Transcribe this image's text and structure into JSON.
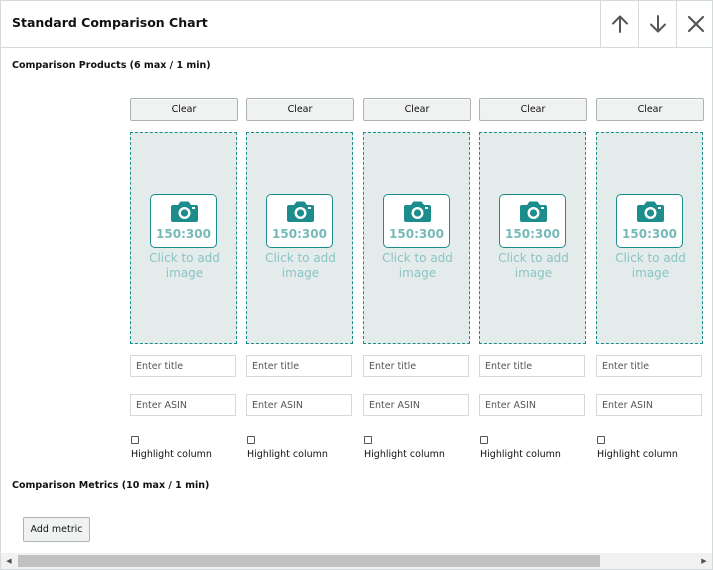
{
  "header": {
    "title": "Standard Comparison Chart",
    "move_up_icon": "arrow-up-icon",
    "move_down_icon": "arrow-down-icon",
    "remove_icon": "close-icon"
  },
  "products_section": {
    "label": "Comparison Products (6 max / 1 min)",
    "columns": [
      {
        "clear_label": "Clear",
        "image_ratio": "150:300",
        "add_image_text": "Click to add image",
        "title_placeholder": "Enter title",
        "asin_placeholder": "Enter ASIN",
        "highlight_label": "Highlight column",
        "highlighted": false
      },
      {
        "clear_label": "Clear",
        "image_ratio": "150:300",
        "add_image_text": "Click to add image",
        "title_placeholder": "Enter title",
        "asin_placeholder": "Enter ASIN",
        "highlight_label": "Highlight column",
        "highlighted": false
      },
      {
        "clear_label": "Clear",
        "image_ratio": "150:300",
        "add_image_text": "Click to add image",
        "title_placeholder": "Enter title",
        "asin_placeholder": "Enter ASIN",
        "highlight_label": "Highlight column",
        "highlighted": false
      },
      {
        "clear_label": "Clear",
        "image_ratio": "150:300",
        "add_image_text": "Click to add image",
        "title_placeholder": "Enter title",
        "asin_placeholder": "Enter ASIN",
        "highlight_label": "Highlight column",
        "highlighted": false
      },
      {
        "clear_label": "Clear",
        "image_ratio": "150:300",
        "add_image_text": "Click to add image",
        "title_placeholder": "Enter title",
        "asin_placeholder": "Enter ASIN",
        "highlight_label": "Highlight column",
        "highlighted": false
      }
    ]
  },
  "metrics_section": {
    "label": "Comparison Metrics (10 max / 1 min)",
    "add_metric_label": "Add metric"
  },
  "colors": {
    "accent_teal": "#1d8c8c",
    "image_bg": "#e3ebeb",
    "border": "#d5d9d9",
    "button_bg": "#f0f2f2"
  }
}
